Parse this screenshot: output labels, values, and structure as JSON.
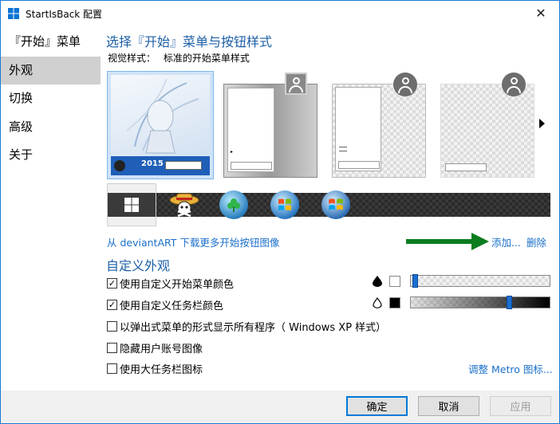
{
  "window": {
    "title": "StartIsBack 配置",
    "close_glyph": "✕"
  },
  "sidebar": {
    "items": [
      {
        "label": "『开始』菜单"
      },
      {
        "label": "外观"
      },
      {
        "label": "切换"
      },
      {
        "label": "高级"
      },
      {
        "label": "关于"
      }
    ],
    "active_index": 1
  },
  "main": {
    "heading": "选择『开始』菜单与按钮样式",
    "visual_style_label": "视觉样式：",
    "visual_style_value": "标准的开始菜单样式",
    "thumbnail_banner_text": "2015"
  },
  "buttons_section": {
    "download_link": "从 deviantART 下载更多开始按钮图像",
    "add_link": "添加...",
    "delete_link": "删除"
  },
  "custom": {
    "heading": "自定义外观",
    "options": [
      {
        "label": "使用自定义开始菜单颜色",
        "checked": true
      },
      {
        "label": "使用自定义任务栏颜色",
        "checked": true
      },
      {
        "label": "以弹出式菜单的形式显示所有程序（ Windows XP 样式）",
        "checked": false
      },
      {
        "label": "隐藏用户账号图像",
        "checked": false
      },
      {
        "label": "使用大任务栏图标",
        "checked": false
      }
    ],
    "metro_link": "调整 Metro 图标...",
    "startmenu_slider_value": 0.0,
    "taskbar_slider_value": 0.72
  },
  "footer": {
    "ok": "确定",
    "cancel": "取消",
    "apply": "应用"
  },
  "colors": {
    "accent": "#1a6fc9",
    "heading": "#1d5fa6",
    "arrow": "#0a7d1f"
  },
  "icons": [
    "app-icon",
    "close-icon",
    "user-icon",
    "windows-logo-icon",
    "straw-hat-icon",
    "clover-orb-icon",
    "windows7-orb-icon",
    "green-arrow-icon",
    "water-drop-icon",
    "chevron-right-icon"
  ]
}
